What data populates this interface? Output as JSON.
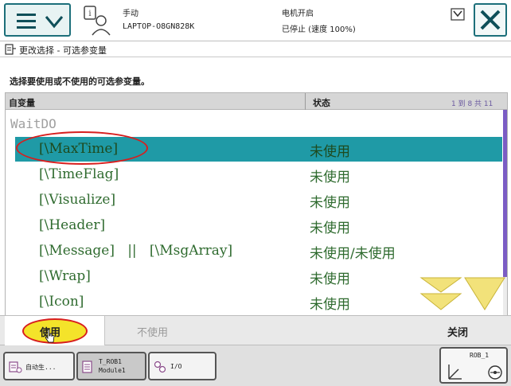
{
  "header": {
    "mode": "手动",
    "host": "LAPTOP-O8GN828K",
    "motor": "电机开启",
    "state": "已停止 (速度 100%)"
  },
  "page": {
    "title": "更改选择 - 可选参变量",
    "instruction": "选择要使用或不使用的可选参变量。"
  },
  "table": {
    "col_var": "自变量",
    "col_state": "状态",
    "page_count": "1 到 8 共 11",
    "group": "WaitDO",
    "rows": [
      {
        "name": "[\\MaxTime]",
        "status": "未使用",
        "selected": true
      },
      {
        "name": "[\\TimeFlag]",
        "status": "未使用"
      },
      {
        "name": "[\\Visualize]",
        "status": "未使用"
      },
      {
        "name": "[\\Header]",
        "status": "未使用"
      },
      {
        "name": "[\\Message]   ||   [\\MsgArray]",
        "status": "未使用/未使用"
      },
      {
        "name": "[\\Wrap]",
        "status": "未使用"
      },
      {
        "name": "[\\Icon]",
        "status": "未使用"
      }
    ]
  },
  "commands": {
    "use": "使用",
    "unuse": "不使用",
    "close": "关闭"
  },
  "taskbar": {
    "auto": "自动生...",
    "module_1": "T_ROB1",
    "module_2": "Module1",
    "io": "I/O",
    "rob": "ROB_1"
  },
  "colors": {
    "accent": "#1c6f7a",
    "selected_row": "#1f9aa6",
    "row_text": "#2f6b2f",
    "scroll_arrow": "#f2e27a",
    "highlight": "#d81e1e"
  },
  "icons": [
    "menu-icon",
    "chevron-down-icon",
    "user-status-icon",
    "status-icon",
    "close-icon",
    "parameter-icon",
    "scroll-down-double-icon",
    "scroll-down-icon",
    "cursor-icon",
    "auto-generate-icon",
    "module-icon",
    "io-icon",
    "robot-axes-icon"
  ]
}
